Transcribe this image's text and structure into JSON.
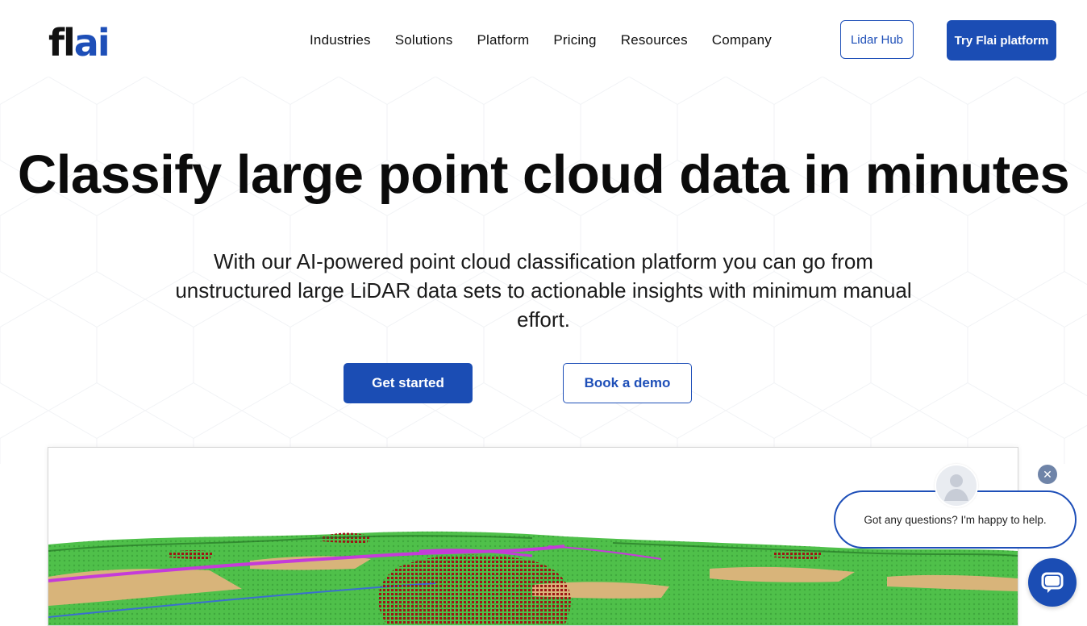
{
  "brand": {
    "logo_fl": "fl",
    "logo_ai": "ai",
    "accent": "#1b4db4",
    "text": "#111111"
  },
  "nav": {
    "items": [
      {
        "label": "Industries"
      },
      {
        "label": "Solutions"
      },
      {
        "label": "Platform"
      },
      {
        "label": "Pricing"
      },
      {
        "label": "Resources"
      },
      {
        "label": "Company"
      }
    ],
    "lidar_hub": "Lidar Hub",
    "try_platform": "Try Flai platform"
  },
  "hero": {
    "title": "Classify large point cloud data in minutes",
    "subtitle": "With our AI-powered point cloud classification platform you can go from unstructured large LiDAR data sets to actionable insights with minimum manual effort.",
    "cta_primary": "Get started",
    "cta_secondary": "Book a demo"
  },
  "preview": {
    "icon": "point-cloud-terrain"
  },
  "chat": {
    "message": "Got any questions? I'm happy to help.",
    "close_icon": "close-icon",
    "launcher_icon": "chat-icon"
  }
}
